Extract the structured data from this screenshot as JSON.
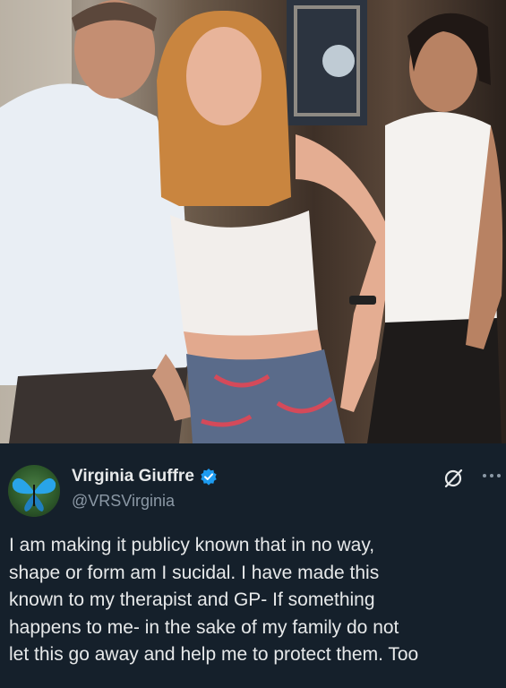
{
  "tweet": {
    "display_name": "Virginia Giuffre",
    "handle": "@VRSVirginia",
    "text": "I am making it publicy known that in no way,\nshape or form am I sucidal. I have made this\nknown to my therapist and GP- If something\nhappens to me- in the sake of my family do not\nlet this go away and help me to protect them. Too",
    "verified": true
  },
  "icons": {
    "verified": "verified-badge-icon",
    "grok": "grok-slash-icon",
    "more": "more-options-icon",
    "avatar": "butterfly-avatar"
  },
  "colors": {
    "background": "#15202b",
    "text_primary": "#e7e9ea",
    "text_secondary": "#8b98a5",
    "verified_blue": "#1d9bf0"
  }
}
